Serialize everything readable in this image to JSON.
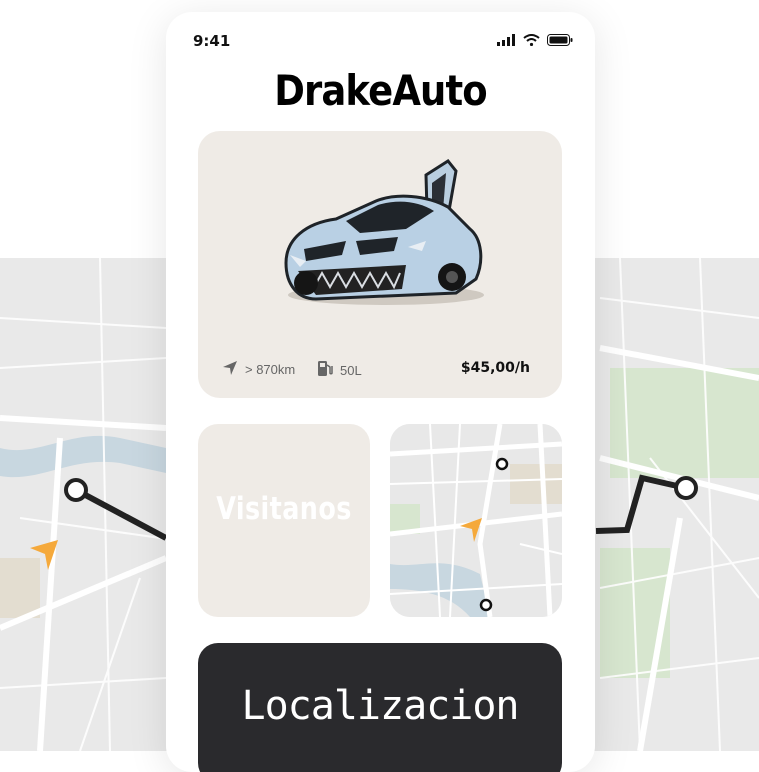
{
  "status_bar": {
    "time": "9:41"
  },
  "app": {
    "title": "DrakeAuto"
  },
  "car": {
    "distance": "> 870km",
    "fuel": "50L",
    "price": "$45,00/h"
  },
  "cards": {
    "visit_label": "Visitanos"
  },
  "location_button": {
    "label": "Localizacion"
  },
  "colors": {
    "card_bg": "#efebe6",
    "accent": "#f5a93b",
    "dark_button": "#2a2a2d",
    "route": "#222222"
  },
  "icons": {
    "status": [
      "signal-icon",
      "wifi-icon",
      "battery-icon"
    ],
    "distance": "navigation-arrow-icon",
    "fuel": "fuel-pump-icon",
    "map_pointer": "location-arrow-icon"
  }
}
